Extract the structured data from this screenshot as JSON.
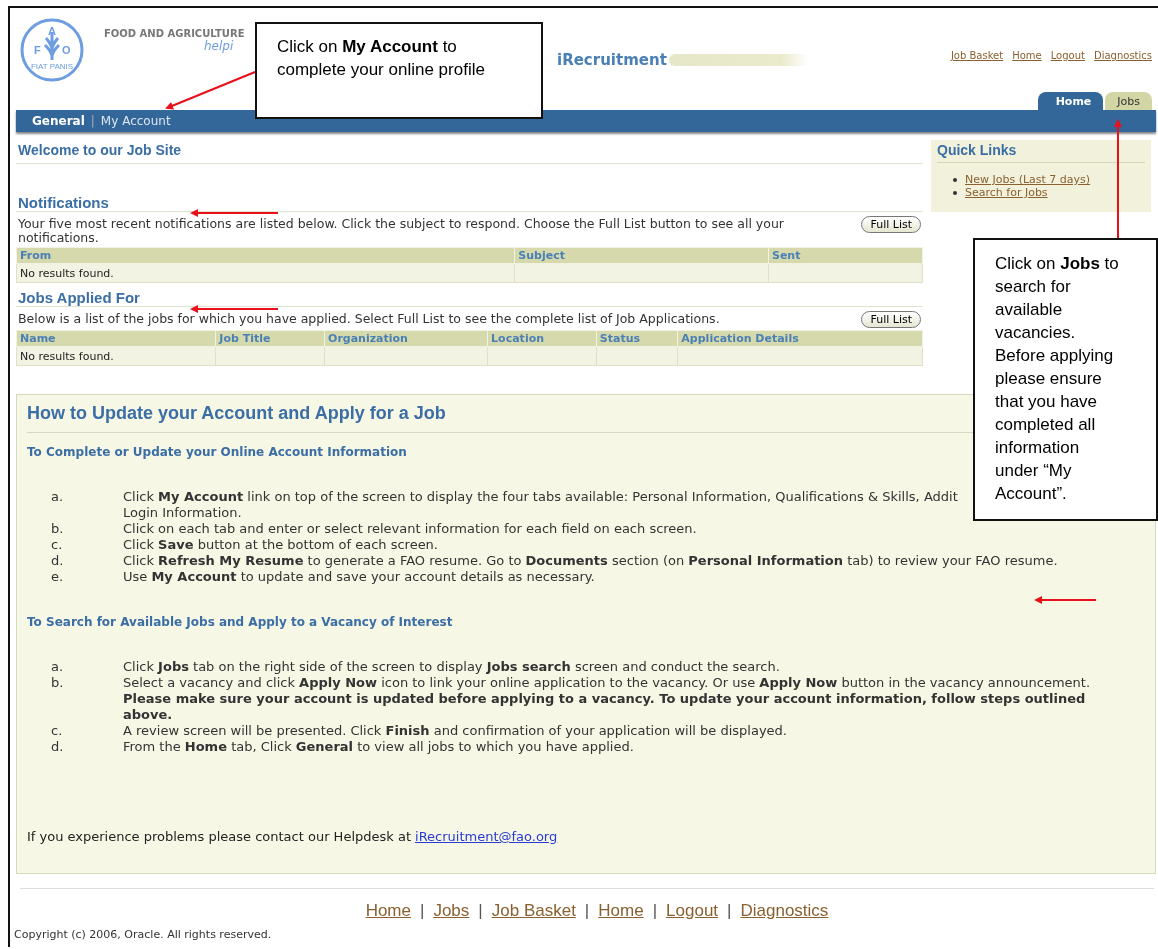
{
  "header": {
    "logo": {
      "letters": [
        "F",
        "A",
        "O"
      ],
      "motto": "FIAT PANIS"
    },
    "org_name": "FOOD AND AGRICULTURE",
    "tagline": "helpi",
    "app_title": "iRecruitment",
    "global_links": [
      "Job Basket",
      "Home",
      "Logout",
      "Diagnostics"
    ]
  },
  "tabs": [
    {
      "label": "Home",
      "selected": true
    },
    {
      "label": "Jobs",
      "selected": false
    }
  ],
  "subnav": {
    "separator": "|",
    "items": [
      {
        "label": "General",
        "selected": true
      },
      {
        "label": "My Account",
        "selected": false
      }
    ]
  },
  "page_title": "Welcome to our Job Site",
  "notifications": {
    "title": "Notifications",
    "description": "Your five most recent notifications are listed below. Click the subject to respond. Choose the Full List button to see all your notifications.",
    "button": "Full List",
    "columns": [
      "From",
      "Subject",
      "Sent"
    ],
    "empty_message": "No results found."
  },
  "jobs_applied": {
    "title": "Jobs Applied For",
    "description": "Below is a list of the jobs for which you have applied. Select Full List to see the complete list of Job Applications.",
    "button": "Full List",
    "columns": [
      "Name",
      "Job Title",
      "Organization",
      "Location",
      "Status",
      "Application Details"
    ],
    "empty_message": "No results found."
  },
  "quick_links": {
    "title": "Quick Links",
    "items": [
      "New Jobs (Last 7 days)",
      "Search for Jobs"
    ]
  },
  "guide": {
    "title": "How to Update your Account and Apply for a Job",
    "sections": [
      {
        "heading": "To Complete or Update your Online Account Information",
        "steps": [
          {
            "marker": "a.",
            "lines": [
              "Click **My Account** link on top of the screen to display the four tabs available: Personal Information, Qualifications & Skills, Addit",
              "Login Information."
            ]
          },
          {
            "marker": "b.",
            "lines": [
              "Click on each tab and enter or select relevant information for each field on each screen."
            ]
          },
          {
            "marker": "c.",
            "lines": [
              "Click **Save** button at the bottom of each screen."
            ]
          },
          {
            "marker": "d.",
            "lines": [
              "Click **Refresh My Resume** to generate a FAO resume. Go to **Documents** section (on **Personal Information** tab) to review your FAO resume."
            ]
          },
          {
            "marker": "e.",
            "lines": [
              "Use **My Account** to update and save your account details as necessary."
            ]
          }
        ]
      },
      {
        "heading": "To Search for Available Jobs and Apply to a Vacancy of Interest",
        "steps": [
          {
            "marker": "a.",
            "lines": [
              "Click **Jobs** tab on the right side of the screen to display **Jobs search** screen and conduct the search."
            ]
          },
          {
            "marker": "b.",
            "lines": [
              "Select a vacancy and click **Apply Now** icon to link your online application to the vacancy. Or use **Apply Now** button in the vacancy announcement. **Please make sure your account is updated before applying to a vacancy. To update your account information, follow steps outlined above.**"
            ]
          },
          {
            "marker": "c.",
            "lines": [
              "A review screen will be presented. Click **Finish** and confirmation of your application will be displayed."
            ]
          },
          {
            "marker": "d.",
            "lines": [
              "From the **Home** tab, Click **General** to view all jobs to which you have applied."
            ]
          }
        ]
      }
    ],
    "contact": {
      "text": "If you experience problems please contact our Helpdesk at",
      "link": "iRecruitment@fao.org"
    }
  },
  "footer": {
    "separator": "|",
    "links": [
      "Home",
      "Jobs",
      "Job Basket",
      "Home",
      "Logout",
      "Diagnostics"
    ],
    "copyright": "Copyright (c) 2006, Oracle. All rights reserved."
  },
  "callouts": [
    {
      "text": "Click on **My Account** to complete your online profile"
    },
    {
      "text": "Click on **Jobs** to search for available vacancies. Before applying please ensure that you have completed all information under “My Account”."
    }
  ]
}
